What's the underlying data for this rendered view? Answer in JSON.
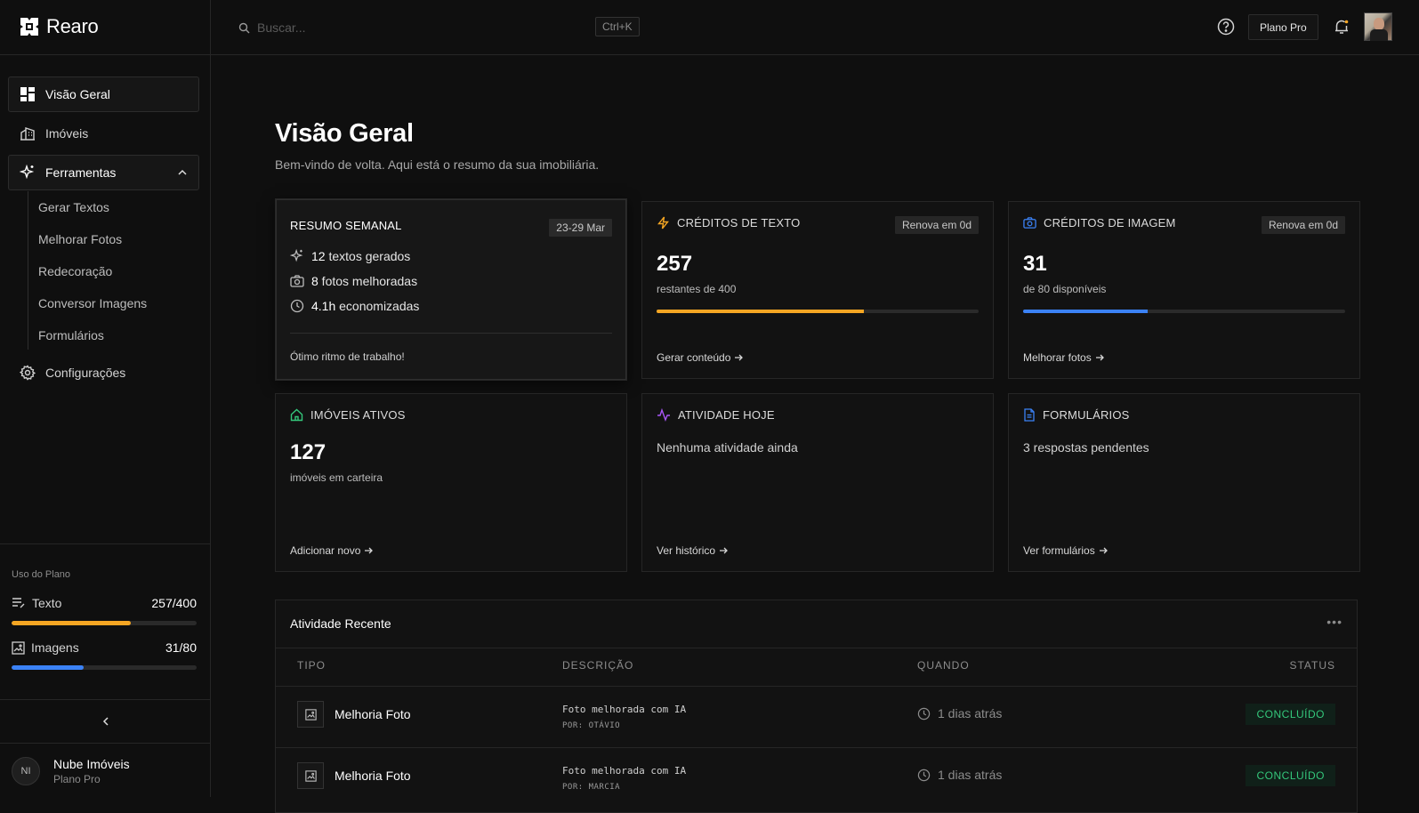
{
  "app": {
    "name": "Rearo"
  },
  "sidebar": {
    "items": [
      {
        "label": "Visão Geral"
      },
      {
        "label": "Imóveis"
      },
      {
        "label": "Ferramentas"
      },
      {
        "label": "Configurações"
      }
    ],
    "subitems": [
      {
        "label": "Gerar Textos"
      },
      {
        "label": "Melhorar Fotos"
      },
      {
        "label": "Redecoração"
      },
      {
        "label": "Conversor Imagens"
      },
      {
        "label": "Formulários"
      }
    ],
    "usage": {
      "title": "Uso do Plano",
      "text": {
        "label": "Texto",
        "value": "257/400",
        "fraction": 0.6425,
        "color": "#f5a623"
      },
      "images": {
        "label": "Imagens",
        "value": "31/80",
        "fraction": 0.3875,
        "color": "#3b82f6"
      }
    },
    "user": {
      "initials": "NI",
      "name": "Nube Imóveis",
      "plan": "Plano Pro"
    }
  },
  "topbar": {
    "search_placeholder": "Buscar...",
    "shortcut": "Ctrl+K",
    "plan_button": "Plano Pro"
  },
  "main": {
    "title": "Visão Geral",
    "subtitle": "Bem-vindo de volta. Aqui está o resumo da sua imobiliária.",
    "weekly": {
      "title": "RESUMO SEMANAL",
      "range": "23-29 Mar",
      "items": [
        {
          "num": "12",
          "text": " textos gerados"
        },
        {
          "num": "8",
          "text": " fotos melhoradas"
        },
        {
          "num": "4.1h",
          "text": " economizadas"
        }
      ],
      "footer": "Ótimo ritmo de trabalho!"
    },
    "text_credits": {
      "title": "CRÉDITOS DE TEXTO",
      "chip": "Renova em 0d",
      "value": "257",
      "caption": "restantes de 400",
      "fraction": 0.6425,
      "color": "#f5a623",
      "link": "Gerar conteúdo"
    },
    "image_credits": {
      "title": "CRÉDITOS DE IMAGEM",
      "chip": "Renova em 0d",
      "value": "31",
      "caption": "de 80 disponíveis",
      "fraction": 0.3875,
      "color": "#3b82f6",
      "link": "Melhorar fotos"
    },
    "properties": {
      "title": "IMÓVEIS ATIVOS",
      "value": "127",
      "caption": "imóveis em carteira",
      "link": "Adicionar novo"
    },
    "activity": {
      "title": "ATIVIDADE HOJE",
      "text": "Nenhuma atividade ainda",
      "link": "Ver histórico"
    },
    "forms": {
      "title": "FORMULÁRIOS",
      "text": "3 respostas pendentes",
      "link": "Ver formulários"
    }
  },
  "recent": {
    "title": "Atividade Recente",
    "columns": [
      "TIPO",
      "DESCRIÇÃO",
      "QUANDO",
      "STATUS"
    ],
    "rows": [
      {
        "type": "Melhoria Foto",
        "desc": "Foto melhorada com IA",
        "by": "POR: OTÁVIO",
        "when": "1 dias atrás",
        "status": "CONCLUÍDO"
      },
      {
        "type": "Melhoria Foto",
        "desc": "Foto melhorada com IA",
        "by": "POR: MARCIA",
        "when": "1 dias atrás",
        "status": "CONCLUÍDO"
      }
    ]
  }
}
